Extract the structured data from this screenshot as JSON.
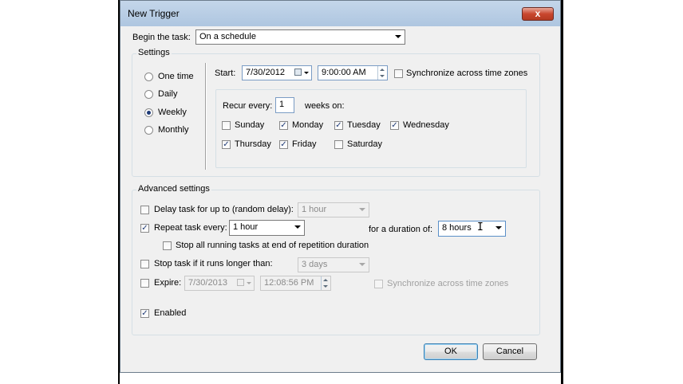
{
  "window": {
    "title": "New Trigger",
    "close_glyph": "x"
  },
  "begin": {
    "label": "Begin the task:",
    "value": "On a schedule"
  },
  "settings": {
    "label": "Settings",
    "schedule_options": [
      {
        "label": "One time",
        "selected": false
      },
      {
        "label": "Daily",
        "selected": false
      },
      {
        "label": "Weekly",
        "selected": true
      },
      {
        "label": "Monthly",
        "selected": false
      }
    ],
    "start_label": "Start:",
    "start_date": "7/30/2012",
    "start_time": "9:00:00 AM",
    "sync_label": "Synchronize across time zones",
    "sync_checked": false,
    "recur_label": "Recur every:",
    "recur_value": "1",
    "weeks_on_label": "weeks on:",
    "days": [
      {
        "label": "Sunday",
        "checked": false
      },
      {
        "label": "Monday",
        "checked": true
      },
      {
        "label": "Tuesday",
        "checked": true
      },
      {
        "label": "Wednesday",
        "checked": true
      },
      {
        "label": "Thursday",
        "checked": true
      },
      {
        "label": "Friday",
        "checked": true
      },
      {
        "label": "Saturday",
        "checked": false
      }
    ]
  },
  "advanced": {
    "label": "Advanced settings",
    "delay": {
      "label": "Delay task for up to (random delay):",
      "checked": false,
      "value": "1 hour"
    },
    "repeat": {
      "label": "Repeat task every:",
      "checked": true,
      "value": "1 hour",
      "duration_label": "for a duration of:",
      "duration_value": "8 hours"
    },
    "stop_running": {
      "label": "Stop all running tasks at end of repetition duration",
      "checked": false
    },
    "stop_longer": {
      "label": "Stop task if it runs longer than:",
      "checked": false,
      "value": "3 days"
    },
    "expire": {
      "label": "Expire:",
      "checked": false,
      "date": "7/30/2013",
      "time": "12:08:56 PM",
      "sync_label": "Synchronize across time zones"
    },
    "enabled": {
      "label": "Enabled",
      "checked": true
    }
  },
  "buttons": {
    "ok": "OK",
    "cancel": "Cancel"
  },
  "check_glyph": "✓"
}
